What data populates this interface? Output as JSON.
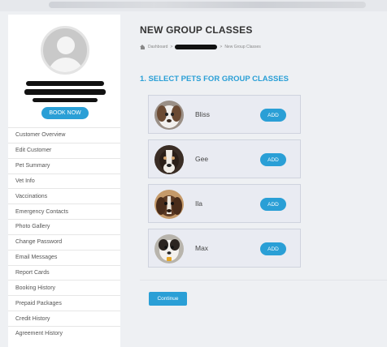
{
  "sidebar": {
    "book_now_label": "BOOK NOW",
    "items": [
      {
        "label": "Customer Overview"
      },
      {
        "label": "Edit Customer"
      },
      {
        "label": "Pet Summary"
      },
      {
        "label": "Vet Info"
      },
      {
        "label": "Vaccinations"
      },
      {
        "label": "Emergency Contacts"
      },
      {
        "label": "Photo Gallery"
      },
      {
        "label": "Change Password"
      },
      {
        "label": "Email Messages"
      },
      {
        "label": "Report Cards"
      },
      {
        "label": "Booking History"
      },
      {
        "label": "Prepaid Packages"
      },
      {
        "label": "Credit History"
      },
      {
        "label": "Agreement History"
      }
    ]
  },
  "main": {
    "title": "NEW GROUP CLASSES",
    "breadcrumb": {
      "home": "Dashboard",
      "separator": ">",
      "current": "New Group Classes"
    },
    "section_title": "1. SELECT PETS FOR GROUP CLASSES",
    "pets": [
      {
        "name": "Bliss",
        "add_label": "ADD"
      },
      {
        "name": "Gee",
        "add_label": "ADD"
      },
      {
        "name": "Ila",
        "add_label": "ADD"
      },
      {
        "name": "Max",
        "add_label": "ADD"
      }
    ],
    "continue_label": "Continue"
  },
  "colors": {
    "accent": "#2a9fd6",
    "card_bg": "#e9ebf2",
    "page_bg": "#eef0f3"
  }
}
